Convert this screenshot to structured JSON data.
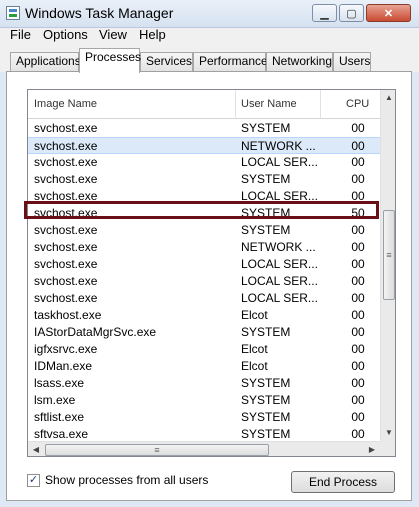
{
  "window": {
    "title": "Windows Task Manager",
    "controls": {
      "minimize": "▁",
      "maximize": "▢",
      "close": "✕"
    }
  },
  "menu": [
    "File",
    "Options",
    "View",
    "Help"
  ],
  "tabs": [
    {
      "label": "Applications",
      "active": false
    },
    {
      "label": "Processes",
      "active": true
    },
    {
      "label": "Services",
      "active": false
    },
    {
      "label": "Performance",
      "active": false
    },
    {
      "label": "Networking",
      "active": false
    },
    {
      "label": "Users",
      "active": false
    }
  ],
  "table": {
    "columns": [
      "Image Name",
      "User Name",
      "CPU"
    ],
    "rows": [
      {
        "name": "svchost.exe",
        "user": "SYSTEM",
        "cpu": "00"
      },
      {
        "name": "svchost.exe",
        "user": "NETWORK ...",
        "cpu": "00",
        "selected": true
      },
      {
        "name": "svchost.exe",
        "user": "LOCAL SER...",
        "cpu": "00"
      },
      {
        "name": "svchost.exe",
        "user": "SYSTEM",
        "cpu": "00"
      },
      {
        "name": "svchost.exe",
        "user": "LOCAL SER...",
        "cpu": "00"
      },
      {
        "name": "svchost.exe",
        "user": "SYSTEM",
        "cpu": "50",
        "highlighted": true
      },
      {
        "name": "svchost.exe",
        "user": "SYSTEM",
        "cpu": "00"
      },
      {
        "name": "svchost.exe",
        "user": "NETWORK ...",
        "cpu": "00"
      },
      {
        "name": "svchost.exe",
        "user": "LOCAL SER...",
        "cpu": "00"
      },
      {
        "name": "svchost.exe",
        "user": "LOCAL SER...",
        "cpu": "00"
      },
      {
        "name": "svchost.exe",
        "user": "LOCAL SER...",
        "cpu": "00"
      },
      {
        "name": "taskhost.exe",
        "user": "Elcot",
        "cpu": "00"
      },
      {
        "name": "IAStorDataMgrSvc.exe",
        "user": "SYSTEM",
        "cpu": "00"
      },
      {
        "name": "igfxsrvc.exe",
        "user": "Elcot",
        "cpu": "00"
      },
      {
        "name": "IDMan.exe",
        "user": "Elcot",
        "cpu": "00"
      },
      {
        "name": "lsass.exe",
        "user": "SYSTEM",
        "cpu": "00"
      },
      {
        "name": "lsm.exe",
        "user": "SYSTEM",
        "cpu": "00"
      },
      {
        "name": "sftlist.exe",
        "user": "SYSTEM",
        "cpu": "00"
      },
      {
        "name": "sftvsa.exe",
        "user": "SYSTEM",
        "cpu": "00"
      }
    ]
  },
  "footer": {
    "show_all_label": "Show processes from all users",
    "show_all_checked": true,
    "end_process_label": "End Process"
  },
  "colors": {
    "highlight_border": "#6b0f17",
    "selected_row": "#dbe9f8"
  },
  "icons": {
    "checkmark": "✓",
    "scroll_up": "▲",
    "scroll_down": "▼",
    "scroll_left": "◀",
    "scroll_right": "▶",
    "grip": "≡"
  }
}
